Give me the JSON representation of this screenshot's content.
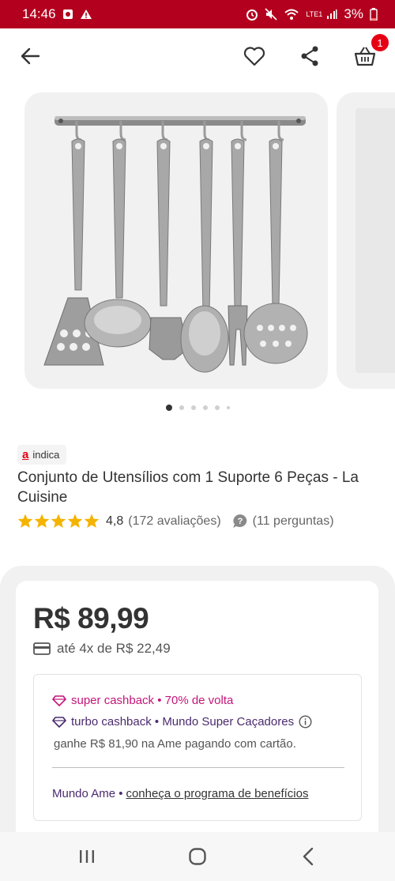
{
  "status_bar": {
    "time": "14:46",
    "battery": "3%",
    "network": "LTE1"
  },
  "header": {
    "cart_count": "1"
  },
  "gallery": {
    "image_description_icon": "utensil-set-image",
    "current_index": 1,
    "total_dots": 6
  },
  "product": {
    "badge_label": "indica",
    "badge_logo": "a",
    "title": "Conjunto de Utensílios com 1 Suporte 6 Peças - La Cuisine",
    "rating": "4,8",
    "rating_stars": 5,
    "reviews": "(172 avaliações)",
    "questions": "(11 perguntas)"
  },
  "pricing": {
    "price": "R$ 89,99",
    "installments": "até 4x de R$ 22,49"
  },
  "cashback": {
    "super_label": "super cashback • 70% de volta",
    "turbo_label": "turbo cashback • Mundo Super Caçadores",
    "note": "ganhe R$ 81,90 na Ame pagando com cartão.",
    "ame_prefix": "Mundo Ame •",
    "ame_link": "conheça o programa de benefícios"
  },
  "colors": {
    "brand_red": "#b3001e",
    "star": "#f5b301",
    "super_pink": "#c4157a",
    "turbo_purple": "#4a2a6e"
  }
}
